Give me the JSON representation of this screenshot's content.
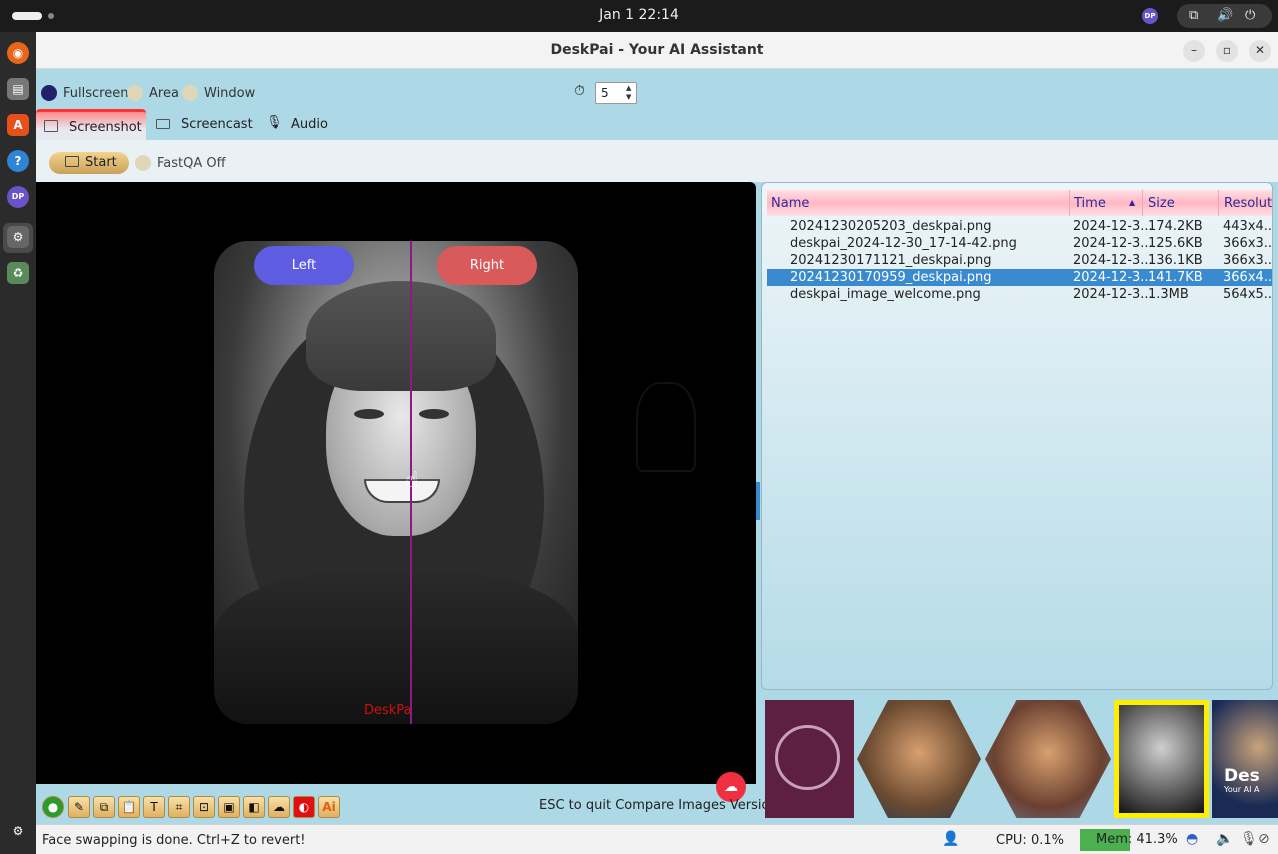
{
  "system": {
    "clock": "Jan 1  22:14",
    "avatar": "DP"
  },
  "window": {
    "title": "DeskPai - Your AI Assistant",
    "minimize": "–",
    "maximize": "▫",
    "close": "✕"
  },
  "capture_modes": {
    "fullscreen": "Fullscreen",
    "area": "Area",
    "window": "Window",
    "selected": "Fullscreen",
    "delay_value": "5"
  },
  "tabs": [
    {
      "label": "Screenshot",
      "active": true
    },
    {
      "label": "Screencast",
      "active": false
    },
    {
      "label": "Audio",
      "active": false
    }
  ],
  "actions": {
    "start": "Start",
    "fastqa": "FastQA Off"
  },
  "compare": {
    "left": "Left",
    "right": "Right",
    "watermark": "DeskPa"
  },
  "toolbar": {
    "hint": "ESC to quit Compare Images Versions",
    "ai_label": "Ai"
  },
  "files": {
    "columns": [
      "Name",
      "Time",
      "Size",
      "Resoluti"
    ],
    "sort_indicator": "▲",
    "rows": [
      {
        "name": "20241230205203_deskpai.png",
        "time": "2024-12-3...",
        "size": "174.2KB",
        "res": "443x4..."
      },
      {
        "name": "deskpai_2024-12-30_17-14-42.png",
        "time": "2024-12-3...",
        "size": "125.6KB",
        "res": "366x3..."
      },
      {
        "name": "20241230171121_deskpai.png",
        "time": "2024-12-3...",
        "size": "136.1KB",
        "res": "366x3..."
      },
      {
        "name": "20241230170959_deskpai.png",
        "time": "2024-12-3...",
        "size": "141.7KB",
        "res": "366x4...",
        "selected": true
      },
      {
        "name": "deskpai_image_welcome.png",
        "time": "2024-12-3...",
        "size": "1.3MB",
        "res": "564x5..."
      }
    ]
  },
  "thumbnail_text": {
    "brand": "Des",
    "tagline": "Your AI A"
  },
  "status": {
    "message": "Face swapping is done. Ctrl+Z to revert!",
    "cpu": "CPU: 0.1%",
    "mem": "Mem: 41.3%",
    "mem_fraction": 0.413
  },
  "colors": {
    "accent_blue": "#3a8ad0",
    "window_bg": "#add8e6",
    "left_pill": "#5e5ce0",
    "right_pill": "#d95a5a",
    "selected_thumb_border": "#ffee00"
  }
}
